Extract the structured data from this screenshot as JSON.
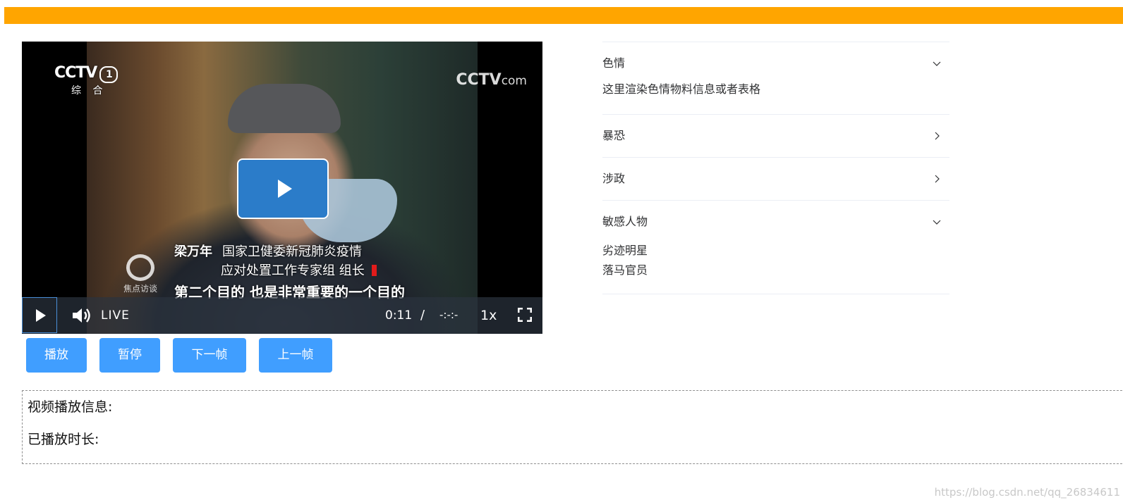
{
  "colors": {
    "top_bar": "#ffa500",
    "primary_button": "#409eff",
    "big_play_button": "#2b7cc9",
    "divider": "#ebeef5"
  },
  "player": {
    "channel_logo": "CCTV",
    "channel_number": "1",
    "channel_sub": "综 合",
    "corner_logo_main": "CCTV",
    "corner_logo_suffix": "com",
    "program_logo_text": "焦点访谈",
    "subtitle_name": "梁万年",
    "subtitle_title_line1": "国家卫健委新冠肺炎疫情",
    "subtitle_title_line2": "应对处置工作专家组 组长",
    "subtitle_speech": "第二个目的 也是非常重要的一个目的",
    "controls": {
      "live_label": "LIVE",
      "current_time": "0:11",
      "time_separator": "/",
      "duration": "-:-:-",
      "playback_rate": "1x"
    }
  },
  "buttons": {
    "play": "播放",
    "pause": "暂停",
    "next_frame": "下一帧",
    "prev_frame": "上一帧"
  },
  "info": {
    "title": "视频播放信息:",
    "played_duration_label": "已播放时长:"
  },
  "collapse": {
    "items": [
      {
        "title": "色情",
        "expanded": true,
        "content": [
          "这里渲染色情物料信息或者表格"
        ]
      },
      {
        "title": "暴恐",
        "expanded": false,
        "content": []
      },
      {
        "title": "涉政",
        "expanded": false,
        "content": []
      },
      {
        "title": "敏感人物",
        "expanded": true,
        "content": [
          "劣迹明星",
          "落马官员"
        ]
      }
    ]
  },
  "watermark": "https://blog.csdn.net/qq_26834611"
}
